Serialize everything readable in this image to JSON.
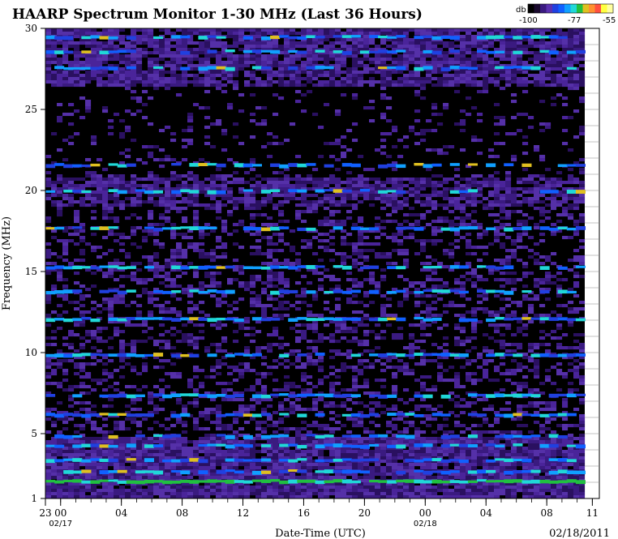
{
  "chart_data": {
    "type": "heatmap",
    "title": "HAARP Spectrum Monitor 1-30 MHz (Last 36 Hours)",
    "xlabel": "Date-Time (UTC)",
    "ylabel": "Frequency (MHz)",
    "ylim": [
      1,
      30
    ],
    "y_ticks": [
      "1",
      "5",
      "10",
      "15",
      "20",
      "25",
      "30"
    ],
    "x_ticks": [
      "23",
      "00",
      "04",
      "08",
      "12",
      "16",
      "20",
      "00",
      "04",
      "08",
      "11"
    ],
    "date_labels": [
      {
        "text": "02/17",
        "at_tick": 1
      },
      {
        "text": "02/18",
        "at_tick": 7
      }
    ],
    "timestamp": "02/18/2011",
    "colorbar": {
      "unit": "db",
      "min_label": "-100",
      "mid_label": "-77",
      "max_label": "-55",
      "colors": [
        "#000000",
        "#1a0a2e",
        "#3a1a80",
        "#5a30b0",
        "#2040e0",
        "#1060ff",
        "#10a0ff",
        "#20d8d8",
        "#20c040",
        "#e0c020",
        "#ff9030",
        "#ff5040",
        "#ffff40",
        "#ffffa0"
      ]
    },
    "bands": [
      {
        "freq": 2.0,
        "level": 0.78,
        "label": "green band"
      },
      {
        "freq": 2.6,
        "level": 0.62
      },
      {
        "freq": 3.3,
        "level": 0.55
      },
      {
        "freq": 4.2,
        "level": 0.5
      },
      {
        "freq": 4.8,
        "level": 0.45
      },
      {
        "freq": 6.1,
        "level": 0.5
      },
      {
        "freq": 7.3,
        "level": 0.58
      },
      {
        "freq": 9.8,
        "level": 0.6
      },
      {
        "freq": 12.0,
        "level": 0.62
      },
      {
        "freq": 13.7,
        "level": 0.5
      },
      {
        "freq": 15.2,
        "level": 0.6
      },
      {
        "freq": 17.6,
        "level": 0.5
      },
      {
        "freq": 19.9,
        "level": 0.45
      },
      {
        "freq": 21.5,
        "level": 0.4
      },
      {
        "freq": 27.5,
        "level": 0.42
      },
      {
        "freq": 28.5,
        "level": 0.45
      },
      {
        "freq": 29.4,
        "level": 0.48
      }
    ]
  }
}
